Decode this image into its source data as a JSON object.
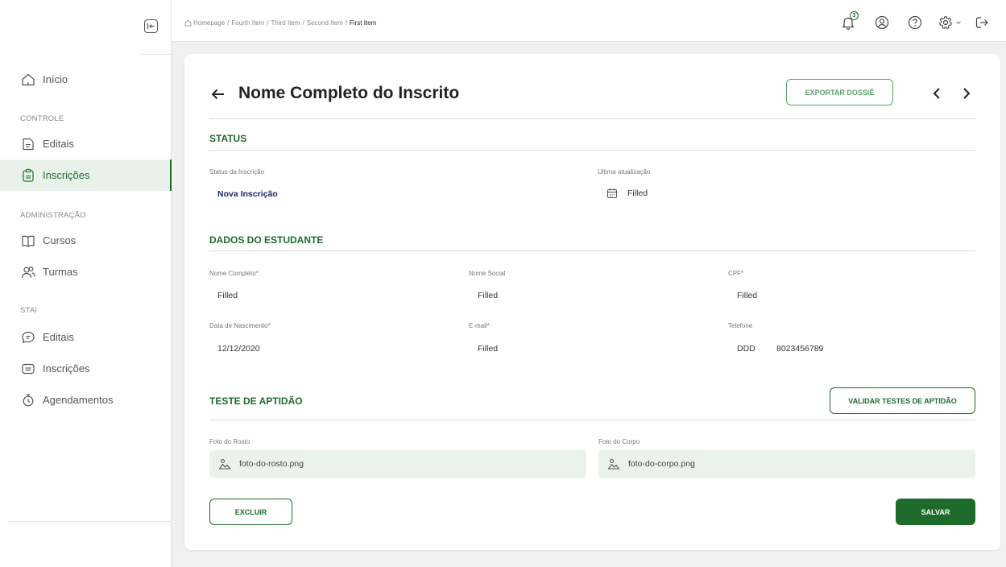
{
  "sidebar": {
    "home_label": "Início",
    "sections": [
      {
        "title": "CONTROLE",
        "items": [
          {
            "label": "Editais",
            "icon": "document-icon"
          },
          {
            "label": "Inscrições",
            "icon": "clipboard-icon",
            "active": true
          }
        ]
      },
      {
        "title": "ADMINISTRAÇÃO",
        "items": [
          {
            "label": "Cursos",
            "icon": "book-icon"
          },
          {
            "label": "Turmas",
            "icon": "users-icon"
          }
        ]
      },
      {
        "title": "STAI",
        "items": [
          {
            "label": "Editais",
            "icon": "chat-bubble-icon"
          },
          {
            "label": "Inscrições",
            "icon": "card-icon"
          },
          {
            "label": "Agendamentos",
            "icon": "stopwatch-icon"
          }
        ]
      }
    ]
  },
  "header": {
    "breadcrumb": [
      "Homepage",
      "Fourth Item",
      "Third Item",
      "Second Item",
      "First Item"
    ],
    "breadcrumb_separator": "/",
    "notification_count": "3"
  },
  "page": {
    "title": "Nome Completo do Inscrito",
    "export_label": "EXPORTAR DOSSIÊ",
    "status": {
      "title": "STATUS",
      "status_label": "Status da Inscrição",
      "status_value": "Nova Inscrição",
      "update_label": "Ultima atualização",
      "update_value": "Filled"
    },
    "student": {
      "title": "DADOS DO ESTUDANTE",
      "full_name_label": "Nome Completo*",
      "full_name_value": "Filled",
      "social_name_label": "Nome Social",
      "social_name_value": "Filled",
      "cpf_label": "CPF*",
      "cpf_value": "Filled",
      "birth_label": "Data de Nascimento*",
      "birth_value": "12/12/2020",
      "email_label": "E-mail*",
      "email_value": "Filled",
      "phone_label": "Telefone",
      "phone_ddd": "DDD",
      "phone_value": "8023456789"
    },
    "aptitude": {
      "title": "TESTE DE APTIDÃO",
      "validate_label": "VALIDAR TESTES DE APTIDÃO",
      "face_label": "Foto do Rosto",
      "face_file": "foto-do-rosto.png",
      "body_label": "Foto do Corpo",
      "body_file": "foto-do-corpo.png"
    },
    "delete_label": "EXCLUIR",
    "save_label": "SALVAR"
  },
  "colors": {
    "primary": "#1e6b2c",
    "primary_light": "#5aa16a",
    "active_bg": "#e9f2ea",
    "file_bg": "#eaf3eb",
    "status_value": "#1a2a6c"
  }
}
